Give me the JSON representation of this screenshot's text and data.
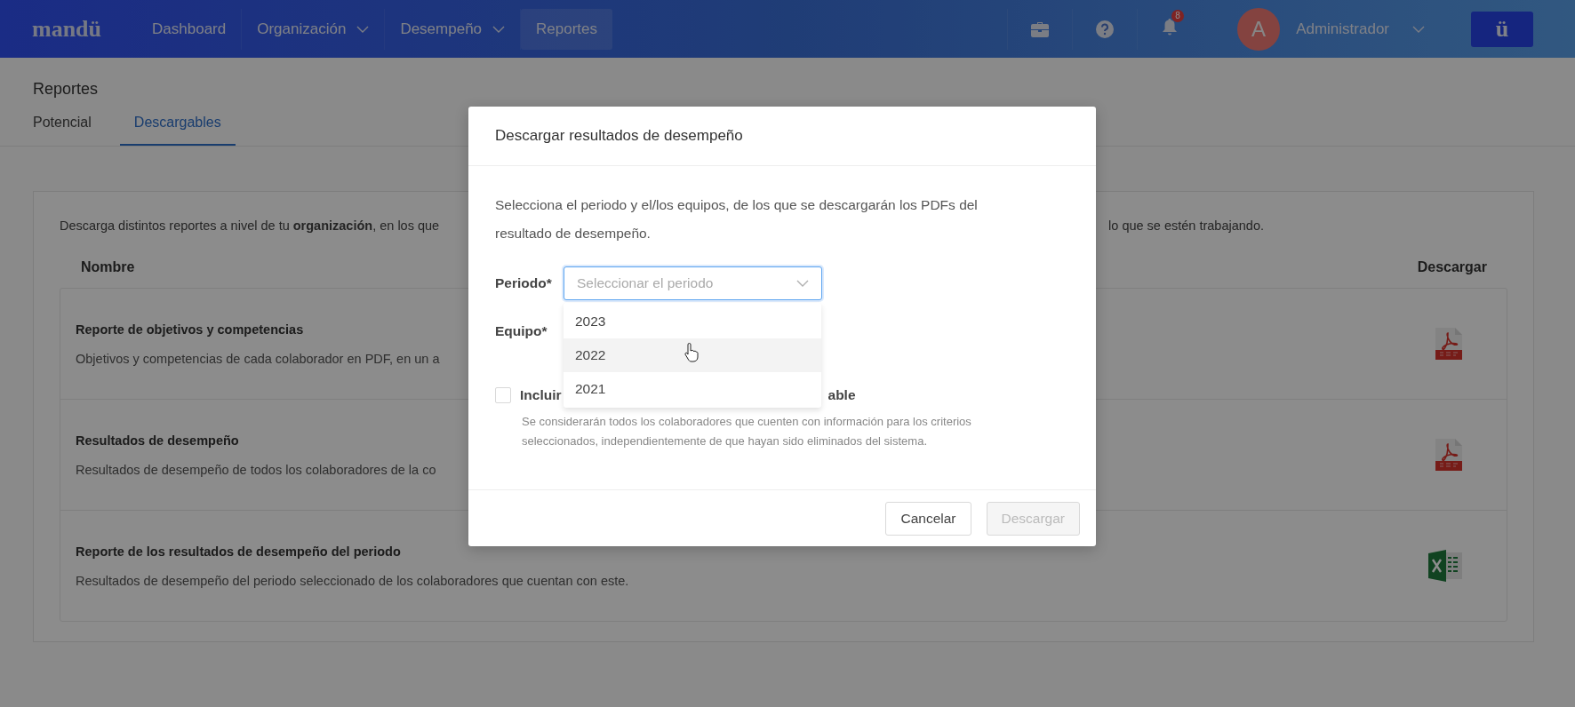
{
  "nav": {
    "logo": "mandü",
    "items": [
      {
        "label": "Dashboard",
        "dropdown": false,
        "selected": false
      },
      {
        "label": "Organización",
        "dropdown": true,
        "selected": false
      },
      {
        "label": "Desempeño",
        "dropdown": true,
        "selected": false
      },
      {
        "label": "Reportes",
        "dropdown": false,
        "selected": true
      }
    ],
    "notifications_badge": "8",
    "user": {
      "avatar_initial": "A",
      "name": "Administrador"
    },
    "brand_button": "ü"
  },
  "page": {
    "title": "Reportes",
    "tabs": [
      {
        "label": "Potencial",
        "selected": false
      },
      {
        "label": "Descargables",
        "selected": true
      }
    ],
    "intro_left": "Descarga distintos reportes a nivel de tu **organización**, en los que",
    "intro_right": "lo que se estén trabajando.",
    "columns": [
      "Nombre",
      "Descargar"
    ],
    "reports": [
      {
        "title": "Reporte de objetivos y competencias",
        "description": "Objetivos y competencias de cada colaborador en PDF, en un a",
        "kind": "pdf"
      },
      {
        "title": "Resultados de desempeño",
        "description": "Resultados de desempeño de todos los colaboradores de la co",
        "kind": "pdf"
      },
      {
        "title": "Reporte de los resultados de desempeño del periodo",
        "description": "Resultados de desempeño del periodo seleccionado de los colaboradores que cuentan con este.",
        "kind": "excel"
      }
    ]
  },
  "modal": {
    "title": "Descargar resultados de desempeño",
    "description": "Selecciona el periodo y el/los equipos, de los que se descargarán los PDFs del resultado de desempeño.",
    "period": {
      "label": "Periodo*",
      "placeholder": "Seleccionar el periodo",
      "focused": true
    },
    "team": {
      "label": "Equipo*"
    },
    "options": [
      {
        "label": "2023",
        "highlighted": false
      },
      {
        "label": "2022",
        "highlighted": true
      },
      {
        "label": "2021",
        "highlighted": false
      }
    ],
    "checkbox": {
      "label_start": "Incluir",
      "label_end": "able",
      "checked": false
    },
    "help": "Se considerarán todos los colaboradores que cuenten con información para los criterios seleccionados, independientemente de que hayan sido eliminados del sistema.",
    "buttons": [
      {
        "label": "Cancelar",
        "disabled": false
      },
      {
        "label": "Descargar",
        "disabled": true
      }
    ]
  }
}
